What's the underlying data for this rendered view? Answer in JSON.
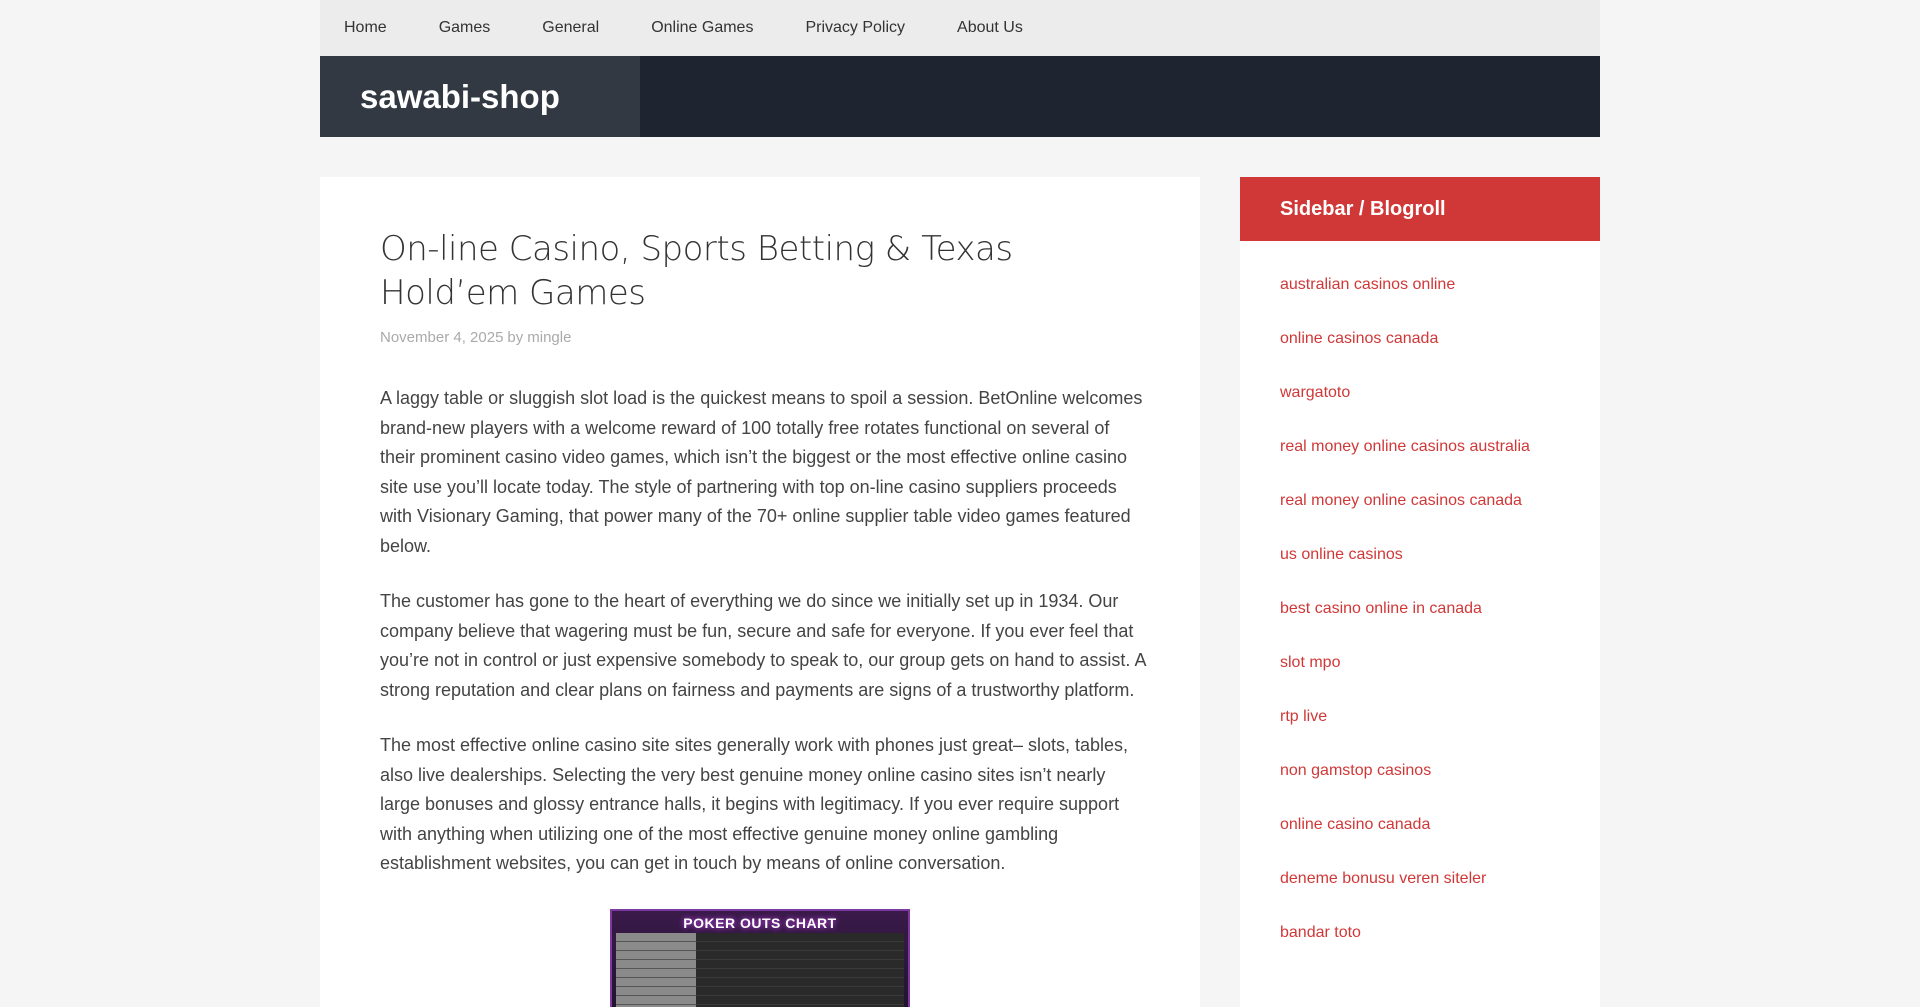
{
  "nav": {
    "items": [
      "Home",
      "Games",
      "General",
      "Online Games",
      "Privacy Policy",
      "About Us"
    ]
  },
  "header": {
    "site_title": "sawabi-shop"
  },
  "post": {
    "title": "On-line Casino, Sports Betting & Texas Hold’em Games",
    "date": "November 4, 2025",
    "by": "by",
    "author": "mingle",
    "paragraphs": [
      "A laggy table or sluggish slot load is the quickest means to spoil a session. BetOnline welcomes brand-new players with a welcome reward of 100 totally free rotates functional on several of their prominent casino video games, which isn’t the biggest or the most effective online casino site use you’ll locate today. The style of partnering with top on-line casino suppliers proceeds with Visionary Gaming, that power many of the 70+ online supplier table video games featured below.",
      "The customer has gone to the heart of everything we do since we initially set up in 1934. Our company believe that wagering must be fun, secure and safe for everyone. If you ever feel that you’re not in control or just expensive somebody to speak to, our group gets on hand to assist. A strong reputation and clear plans on fairness and payments are signs of a trustworthy platform.",
      "The most effective online casino site sites generally work with phones just great– slots, tables, also live dealerships. Selecting the very best genuine money online casino sites isn’t nearly large bonuses and glossy entrance halls, it begins with legitimacy. If you ever require support with anything when utilizing one of the most effective genuine money online gambling establishment websites, you can get in touch by means of online conversation."
    ],
    "image_title": "POKER OUTS CHART"
  },
  "sidebar": {
    "title": "Sidebar / Blogroll",
    "links": [
      "australian casinos online",
      "online casinos canada",
      "wargatoto",
      "real money online casinos australia",
      "real money online casinos canada",
      "us online casinos",
      "best casino online in canada",
      "slot mpo",
      "rtp live",
      "non gamstop casinos",
      "online casino canada",
      "deneme bonusu veren siteler",
      "bandar toto"
    ]
  }
}
